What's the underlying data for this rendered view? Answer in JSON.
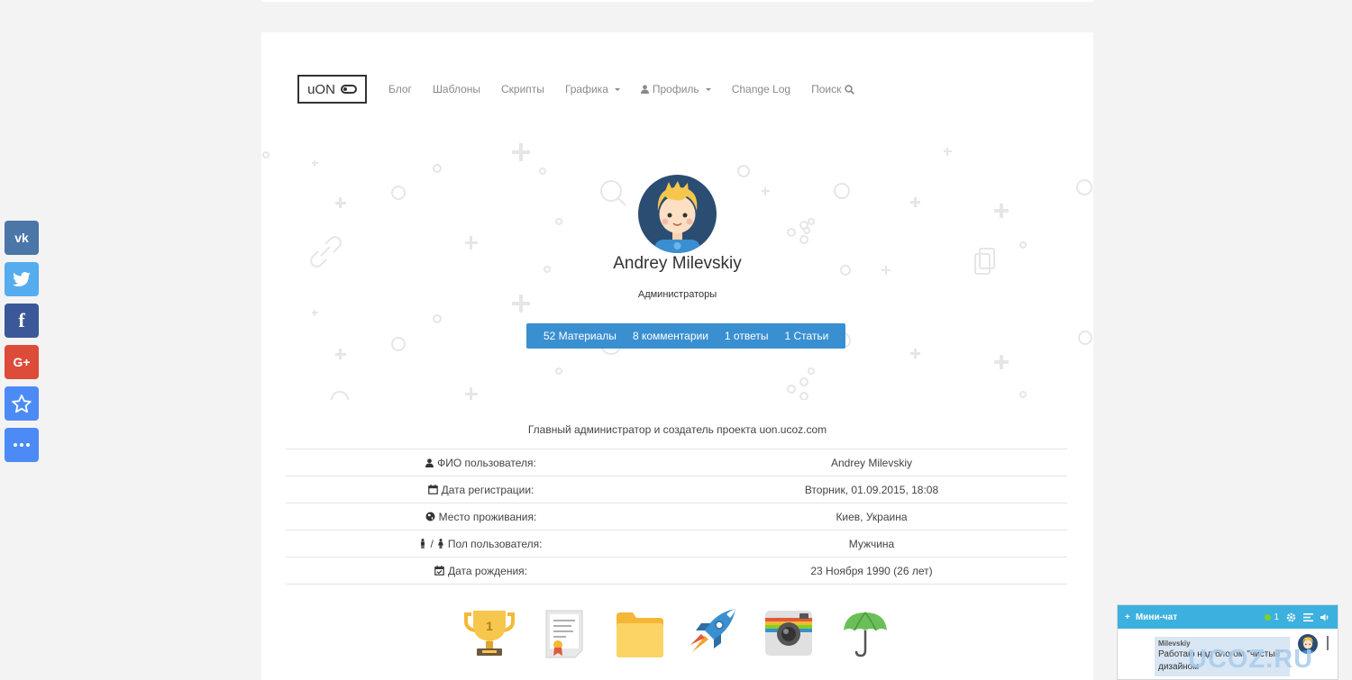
{
  "nav": {
    "logo": "uON",
    "items": [
      {
        "label": "Блог"
      },
      {
        "label": "Шаблоны"
      },
      {
        "label": "Скрипты"
      },
      {
        "label": "Графика"
      },
      {
        "label": "Профиль"
      },
      {
        "label": "Change Log"
      },
      {
        "label": "Поиск"
      }
    ]
  },
  "profile": {
    "name": "Andrey Milevskiy",
    "group": "Администраторы",
    "stats": [
      {
        "label": "52 Материалы"
      },
      {
        "label": "8 комментарии"
      },
      {
        "label": "1 ответы"
      },
      {
        "label": "1 Статьи"
      }
    ],
    "about": "Главный администратор и создатель проекта uon.ucoz.com",
    "rows": [
      {
        "key": "ФИО пользователя:",
        "value": "Andrey Milevskiy",
        "icon": "user-icon"
      },
      {
        "key": "Дата регистрации:",
        "value": "Вторник, 01.09.2015, 18:08",
        "icon": "calendar-icon"
      },
      {
        "key": "Место проживания:",
        "value": "Киев, Украина",
        "icon": "globe-icon"
      },
      {
        "key": "Пол пользователя:",
        "value": "Мужчина",
        "icon": "gender-icon"
      },
      {
        "key": "Дата рождения:",
        "value": "23 Ноября 1990 (26 лет)",
        "icon": "calendar-check-icon"
      }
    ],
    "badges": [
      "trophy-icon",
      "certificate-icon",
      "folder-icon",
      "rocket-icon",
      "camera-icon",
      "umbrella-icon"
    ]
  },
  "share": [
    {
      "label": "vk",
      "color": "#4a76a8"
    },
    {
      "label": "twitter",
      "color": "#55acee"
    },
    {
      "label": "f",
      "color": "#3b5998"
    },
    {
      "label": "G+",
      "color": "#dd4b39"
    },
    {
      "label": "bookmark",
      "color": "#4c8bf5"
    },
    {
      "label": "more",
      "color": "#4c8bf5"
    }
  ],
  "minichat": {
    "title": "Мини-чат",
    "online": "1",
    "author": "Milevskiy",
    "message": "Работаю над блогом \"чистый\" дизайном"
  },
  "watermark": "UCOZ.RU",
  "colors": {
    "accent": "#3a8fd1",
    "chat": "#3cb0de"
  }
}
